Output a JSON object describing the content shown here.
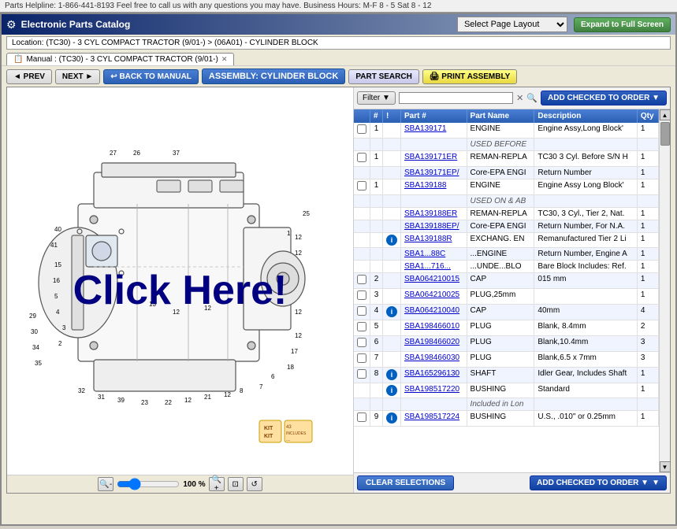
{
  "helpbar": {
    "text": "Parts Helpline: 1-866-441-8193  Feel free to call us with any questions you may have.  Business Hours: M-F 8 - 5  Sat 8 - 12"
  },
  "titlebar": {
    "icon": "⚙",
    "title": "Electronic Parts Catalog"
  },
  "toolbar": {
    "page_layout_label": "Select Page Layout",
    "expand_label": "Expand to Full Screen"
  },
  "location": {
    "text": "Location: (TC30) - 3 CYL COMPACT TRACTOR (9/01-) > (06A01) - CYLINDER BLOCK"
  },
  "tab": {
    "label": "Manual : (TC30) - 3 CYL COMPACT TRACTOR (9/01-)"
  },
  "nav": {
    "prev": "◄ PREV",
    "next": "NEXT ►",
    "back_to_manual": "↩ BACK TO MANUAL",
    "assembly": "ASSEMBLY: CYLINDER BLOCK",
    "part_search": "PART SEARCH",
    "print": "🖨 PRINT ASSEMBLY"
  },
  "filter": {
    "label": "Filter ▼",
    "placeholder": "",
    "add_to_order": "ADD CHECKED TO ORDER  ▼"
  },
  "table": {
    "headers": [
      "",
      "#",
      "!",
      "Part #",
      "Part Name",
      "Description",
      "Qty"
    ],
    "rows": [
      {
        "check": "",
        "num": "1",
        "info": "",
        "part": "SBA139171",
        "name": "ENGINE",
        "desc": "Engine Assy,Long Block'",
        "qty": "1"
      },
      {
        "check": "",
        "num": "",
        "info": "",
        "part": "",
        "name": "USED BEFORE",
        "desc": "",
        "qty": ""
      },
      {
        "check": "",
        "num": "1",
        "info": "",
        "part": "SBA139171ER",
        "name": "REMAN-REPLA",
        "desc": "TC30 3 Cyl. Before S/N H",
        "qty": "1"
      },
      {
        "check": "",
        "num": "",
        "info": "",
        "part": "SBA139171EP/",
        "name": "Core-EPA ENGI",
        "desc": "Return Number",
        "qty": "1"
      },
      {
        "check": "",
        "num": "1",
        "info": "",
        "part": "SBA139188",
        "name": "ENGINE",
        "desc": "Engine Assy Long Block'",
        "qty": "1"
      },
      {
        "check": "",
        "num": "",
        "info": "",
        "part": "",
        "name": "USED ON & AB",
        "desc": "",
        "qty": ""
      },
      {
        "check": "",
        "num": "",
        "info": "",
        "part": "SBA139188ER",
        "name": "REMAN-REPLA",
        "desc": "TC30, 3 Cyl., Tier 2, Nat.",
        "qty": "1"
      },
      {
        "check": "",
        "num": "",
        "info": "",
        "part": "SBA139188EP/",
        "name": "Core-EPA ENGI",
        "desc": "Return Number, For N.A.",
        "qty": "1"
      },
      {
        "check": "",
        "num": "",
        "info": "i",
        "part": "SBA139188R",
        "name": "EXCHANG. EN",
        "desc": "Remanufactured Tier 2 Li",
        "qty": "1"
      },
      {
        "check": "",
        "num": "",
        "info": "",
        "part": "SBA1...88C",
        "name": "...ENGINE",
        "desc": "Return Number, Engine A",
        "qty": "1"
      },
      {
        "check": "",
        "num": "",
        "info": "",
        "part": "SBA1...716...",
        "name": "...UNDE...BLO",
        "desc": "Bare Block Includes: Ref.",
        "qty": "1"
      },
      {
        "check": "",
        "num": "2",
        "info": "",
        "part": "SBA064210015",
        "name": "CAP",
        "desc": "015 mm",
        "qty": "1"
      },
      {
        "check": "",
        "num": "3",
        "info": "",
        "part": "SBA064210025",
        "name": "PLUG,25mm",
        "desc": "",
        "qty": "1"
      },
      {
        "check": "",
        "num": "4",
        "info": "i",
        "part": "SBA064210040",
        "name": "CAP",
        "desc": "40mm",
        "qty": "4"
      },
      {
        "check": "",
        "num": "5",
        "info": "",
        "part": "SBA198466010",
        "name": "PLUG",
        "desc": "Blank, 8.4mm",
        "qty": "2"
      },
      {
        "check": "",
        "num": "6",
        "info": "",
        "part": "SBA198466020",
        "name": "PLUG",
        "desc": "Blank,10.4mm",
        "qty": "3"
      },
      {
        "check": "",
        "num": "7",
        "info": "",
        "part": "SBA198466030",
        "name": "PLUG",
        "desc": "Blank,6.5 x 7mm",
        "qty": "3"
      },
      {
        "check": "",
        "num": "8",
        "info": "i",
        "part": "SBA165296130",
        "name": "SHAFT",
        "desc": "Idler Gear, Includes Shaft",
        "qty": "1"
      },
      {
        "check": "",
        "num": "",
        "info": "i",
        "part": "SBA198517220",
        "name": "BUSHING",
        "desc": "Standard",
        "qty": "1"
      },
      {
        "check": "",
        "num": "",
        "info": "",
        "part": "",
        "name": "Included in Lon",
        "desc": "",
        "qty": ""
      },
      {
        "check": "",
        "num": "9",
        "info": "i",
        "part": "SBA198517224",
        "name": "BUSHING",
        "desc": "U.S., .010\" or 0.25mm",
        "qty": "1"
      }
    ]
  },
  "bottom": {
    "clear_label": "CLEAR SELECTIONS",
    "add_order_label": "ADD CHECKED TO ORDER  ▼"
  },
  "zoom": {
    "percent": "100 %"
  },
  "click_here": "Click Here!"
}
